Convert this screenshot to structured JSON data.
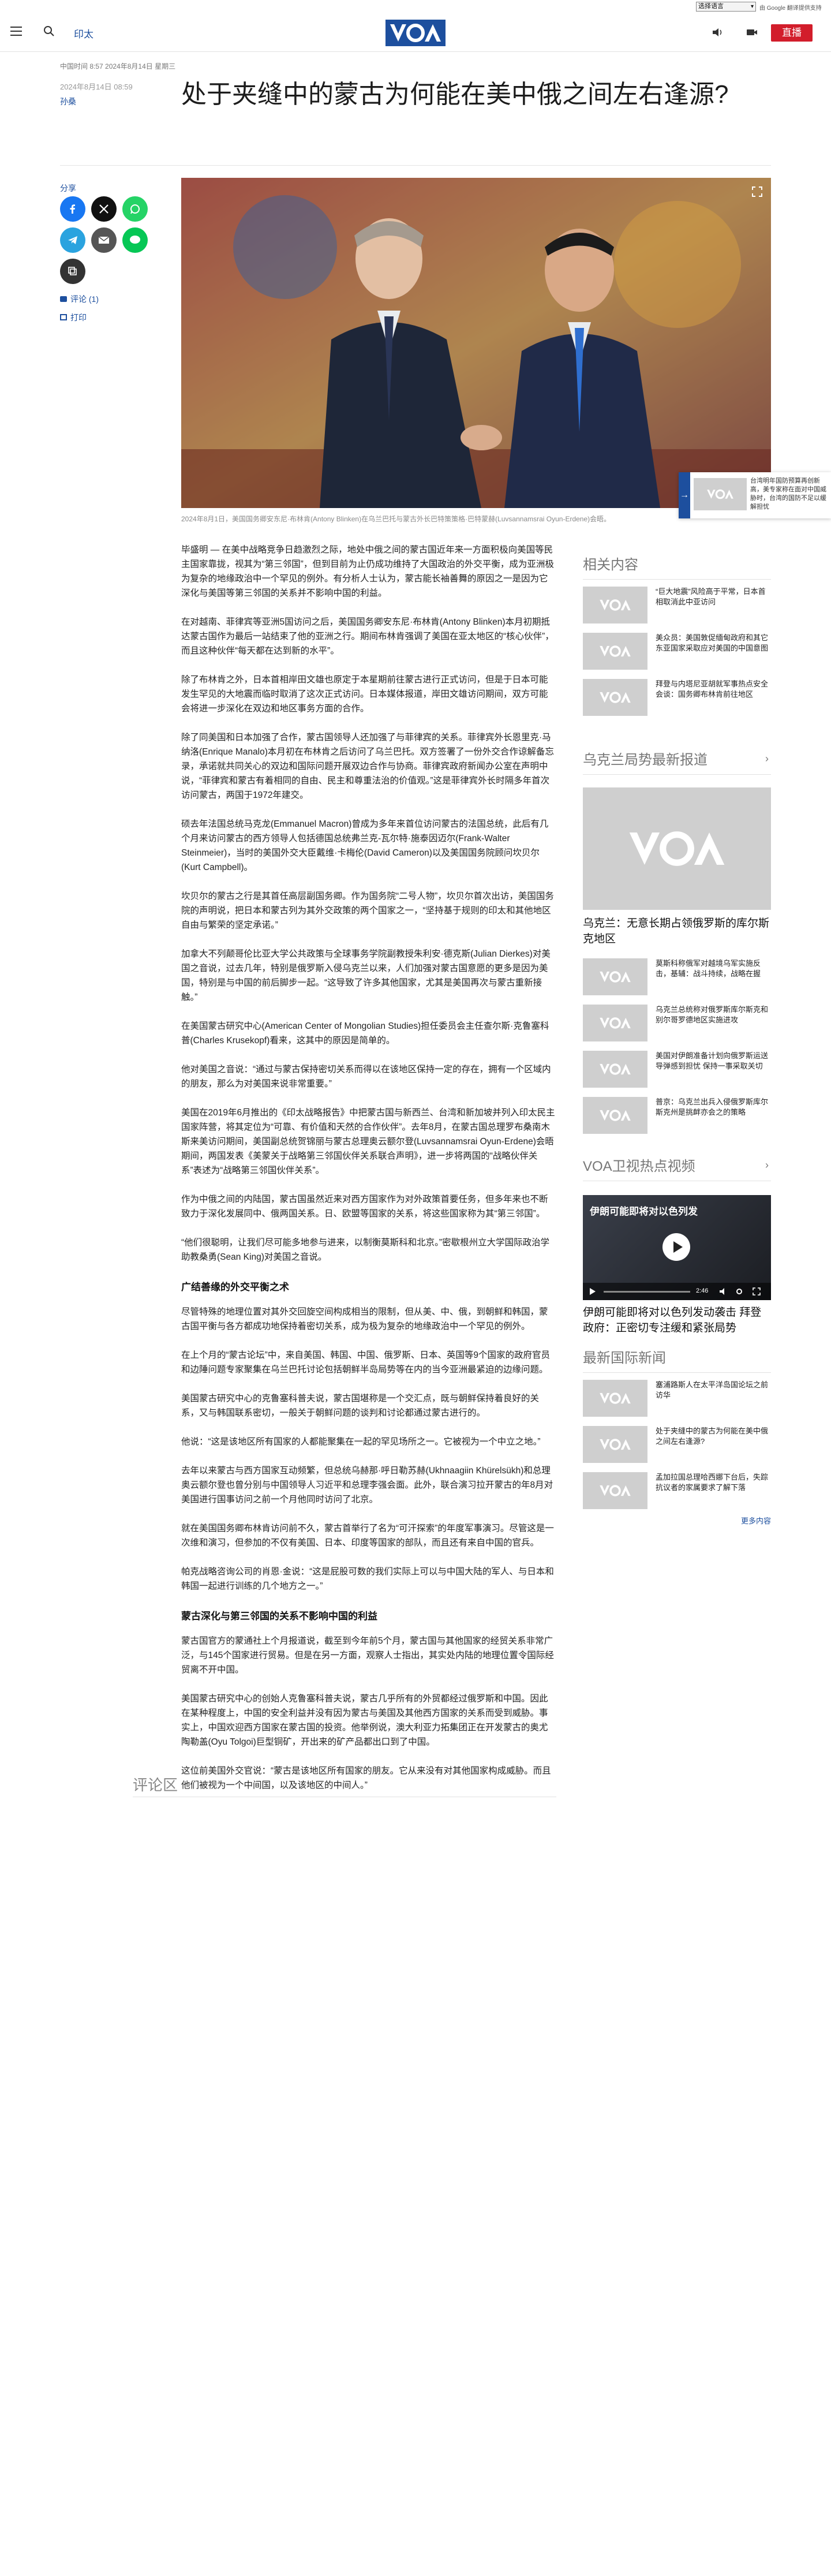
{
  "util": {
    "lang_select": "选择语言",
    "links": "由 Google 翻译提供支持"
  },
  "header": {
    "section": "印太",
    "live": "直播",
    "colors": {
      "brand": "#1d4f9e",
      "live": "#d21d2b"
    }
  },
  "article": {
    "dateline": "中国时间 8:57 2024年8月14日 星期三",
    "published": "2024年8月14日 08:59",
    "author": "孙桑",
    "title": "处于夹缝中的蒙古为何能在美中俄之间左右逢源?",
    "share_label": "分享",
    "comments": "评论 (1)",
    "print": "打印",
    "caption": "2024年8月1日，美国国务卿安东尼·布林肯(Antony Blinken)在乌兰巴托与蒙古外长巴特策策格·巴特蒙赫(Luvsannamsrai Oyun-Erdene)会晤。",
    "paragraphs": [
      "毕盛明 — 在美中战略竞争日趋激烈之际，地处中俄之间的蒙古国近年来一方面积极向美国等民主国家靠拢，视其为“第三邻国”，但到目前为止仍成功维持了大国政治的外交平衡，成为亚洲极为复杂的地缘政治中一个罕见的例外。有分析人士认为，蒙古能长袖善舞的原因之一是因为它深化与美国等第三邻国的关系并不影响中国的利益。",
      "在对越南、菲律宾等亚洲5国访问之后，美国国务卿安东尼·布林肯(Antony Blinken)本月初期抵达蒙古国作为最后一站结束了他的亚洲之行。期间布林肯强调了美国在亚太地区的“核心伙伴”，而且这种伙伴“每天都在达到新的水平”。",
      "除了布林肯之外，日本首相岸田文雄也原定于本星期前往蒙古进行正式访问，但是于日本可能发生罕见的大地震而临时取消了这次正式访问。日本媒体报道，岸田文雄访问期间，双方可能会将进一步深化在双边和地区事务方面的合作。",
      "除了同美国和日本加强了合作，蒙古国领导人还加强了与菲律宾的关系。菲律宾外长恩里克·马纳洛(Enrique Manalo)本月初在布林肯之后访问了乌兰巴托。双方签署了一份外交合作谅解备忘录，承诺就共同关心的双边和国际问题开展双边合作与协商。菲律宾政府新闻办公室在声明中说，“菲律宾和蒙古有着相同的自由、民主和尊重法治的价值观。”这是菲律宾外长时隔多年首次访问蒙古，两国于1972年建交。",
      "硕去年法国总统马克龙(Emmanuel Macron)曾成为多年来首位访问蒙古的法国总统，此后有几个月来访问蒙古的西方领导人包括德国总统弗兰克-瓦尔特·施泰因迈尔(Frank-Walter Steinmeier)，当时的美国外交大臣戴维·卡梅伦(David Cameron)以及美国国务院顾问坎贝尔(Kurt Campbell)。",
      "坎贝尔的蒙古之行是其首任高层副国务卿。作为国务院“二号人物”，坎贝尔首次出访，美国国务院的声明说，把日本和蒙古列为其外交政策的两个国家之一，“坚持基于规则的印太和其他地区自由与繁荣的坚定承诺。”",
      "加拿大不列颠哥伦比亚大学公共政策与全球事务学院副教授朱利安·德克斯(Julian Dierkes)对美国之音说，过去几年，特别是俄罗斯入侵乌克兰以来，人们加强对蒙古国意愿的更多是因为美国，特别是与中国的前后脚步一起。“这导致了许多其他国家，尤其是美国再次与蒙古重新接触。”",
      "在美国蒙古研究中心(American Center of Mongolian Studies)担任委员会主任查尔斯·克鲁塞科普(Charles Krusekopf)看来，这其中的原因是简单的。",
      "他对美国之音说：“通过与蒙古保持密切关系而得以在该地区保持一定的存在，拥有一个区域内的朋友，那么为对美国来说非常重要。”",
      "美国在2019年6月推出的《印太战略报告》中把蒙古国与新西兰、台湾和新加坡并列入印太民主国家阵营，将其定位为“可靠、有价值和天然的合作伙伴”。去年8月，在蒙古国总理罗布桑南木斯来美访问期间，美国副总统贺锦丽与蒙古总理奥云额尔登(Luvsannamsrai Oyun-Erdene)会晤期间，两国发表《美蒙关于战略第三邻国伙伴关系联合声明》，进一步将两国的“战略伙伴关系”表述为“战略第三邻国伙伴关系”。",
      "作为中俄之间的内陆国，蒙古国虽然近来对西方国家作为对外政策首要任务，但多年来也不断致力于深化发展同中、俄两国关系。日、欧盟等国家的关系，将这些国家称为其“第三邻国”。",
      "“他们很聪明，让我们尽可能多地参与进来，以制衡莫斯科和北京。”密歇根州立大学国际政治学助教桑勇(Sean King)对美国之音说。"
    ],
    "subhead_1": "广结善缘的外交平衡之术",
    "paragraphs_2": [
      "尽管特殊的地理位置对其外交回旋空间构成相当的限制，但从美、中、俄，到朝鲜和韩国，蒙古国平衡与各方都成功地保持着密切关系，成为极为复杂的地缘政治中一个罕见的例外。",
      "在上个月的“蒙古论坛”中，来自美国、韩国、中国、俄罗斯、日本、英国等9个国家的政府官员和边陲问题专家聚集在乌兰巴托讨论包括朝鲜半岛局势等在内的当今亚洲最紧迫的边缘问题。",
      "美国蒙古研究中心的克鲁塞科普夫说，蒙古国堪称是一个交汇点，既与朝鲜保持着良好的关系，又与韩国联系密切，一般关于朝鲜问题的谈判和讨论都通过蒙古进行的。",
      "他说：“这是该地区所有国家的人都能聚集在一起的罕见场所之一。它被视为一个中立之地。”",
      "去年以来蒙古与西方国家互动频繁，但总统乌赫那·呼日勒苏赫(Ukhnaagiin Khürelsükh)和总理奥云额尔登也曾分别与中国领导人习近平和总理李强会面。此外，联合演习拉开蒙古的年8月对美国进行国事访问之前一个月他同时访问了北京。",
      "就在美国国务卿布林肯访问前不久，蒙古首举行了名为“可汗探索”的年度军事演习。尽管这是一次维和演习，但参加的不仅有美国、日本、印度等国家的部队，而且还有来自中国的官兵。",
      "帕克战略咨询公司的肖恩·金说：“这是屁股可数的我们实际上可以与中国大陆的军人、与日本和韩国一起进行训练的几个地方之一。”"
    ],
    "subhead_2": "蒙古深化与第三邻国的关系不影响中国的利益",
    "paragraphs_3": [
      "蒙古国官方的蒙通社上个月报道说，截至到今年前5个月，蒙古国与其他国家的经贸关系非常广泛，与145个国家进行贸易。但是在另一方面，观察人士指出，其实处内陆的地理位置令国际经贸离不开中国。",
      "美国蒙古研究中心的创始人克鲁塞科普夫说，蒙古几乎所有的外贸都经过俄罗斯和中国。因此在某种程度上，中国的安全利益并没有因为蒙古与美国及其他西方国家的关系而受到威胁。事实上，中国欢迎西方国家在蒙古国的投资。他举例说，澳大利亚力拓集团正在开发蒙古的奥尤陶勒盖(Oyu Tolgoi)巨型铜矿，开出来的矿产品都出口到了中国。",
      "这位前美国外交官说：“蒙古是该地区所有国家的朋友。它从来没有对其他国家构成威胁。而且他们被视为一个中间国，以及该地区的中间人。”"
    ],
    "comments_heading": "评论区"
  },
  "sidebar": {
    "related_heading": "相关内容",
    "related": [
      "“巨大地震”风险高于平常，日本首相取消此中亚访问",
      "美众员：美国敦促缅甸政府和其它东亚国家采取应对美国的中国意图",
      "拜登与内塔尼亚胡就军事热点安全会谈：国务卿布林肯前往地区"
    ],
    "ukraine_heading": "乌克兰局势最新报道",
    "ukraine_feature": "乌克兰：无意长期占领俄罗斯的库尔斯克地区",
    "ukraine": [
      "莫斯科称俄军对越境乌军实施反击，基辅：战斗持续，战略在握",
      "乌克兰总统称对俄罗斯库尔斯克和别尔哥罗德地区实施进攻",
      "美国对伊朗准备计划向俄罗斯运送导弹感到担忧 保持一事采取关切",
      "普京：乌克兰出兵入侵俄罗斯库尔斯克州是挑衅亦会之的策略"
    ],
    "video_heading": "VOA卫视热点视频",
    "video_overlay": "伊朗可能即将对以色列发",
    "video_time": "2:46",
    "video_title": "伊朗可能即将对以色列发动袭击 拜登政府：正密切专注缓和紧张局势",
    "intl_heading": "最新国际新闻",
    "intl": [
      "塞浦路斯人在太平洋岛国论坛之前访华",
      "处于夹缝中的蒙古为何能在美中俄之间左右逢源?",
      "孟加拉国总理哈西娜下台后，失踪抗议者的家属要求了解下落"
    ],
    "more": "更多内容"
  },
  "floating": {
    "text": "台湾明年国防预算再创新高，美专家称在面对中国威胁时，台湾的国防不足以缓解担忧"
  }
}
